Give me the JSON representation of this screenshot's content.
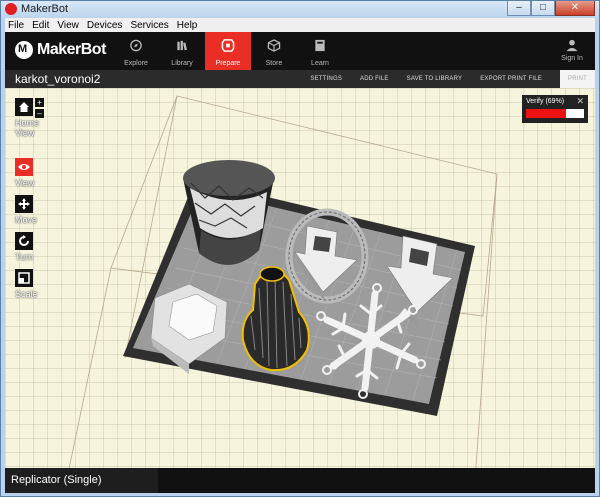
{
  "window": {
    "title": "MakerBot",
    "min": "–",
    "max": "□",
    "close": "✕"
  },
  "menu": [
    "File",
    "Edit",
    "View",
    "Devices",
    "Services",
    "Help"
  ],
  "brand": "MakerBot",
  "nav": [
    {
      "label": "Explore",
      "icon": "compass-icon"
    },
    {
      "label": "Library",
      "icon": "library-icon"
    },
    {
      "label": "Prepare",
      "icon": "prepare-icon",
      "active": true
    },
    {
      "label": "Store",
      "icon": "cube-icon"
    },
    {
      "label": "Learn",
      "icon": "book-icon"
    }
  ],
  "sign_in": "Sign In",
  "project": {
    "title": "karkot_voronoi2",
    "actions": [
      "SETTINGS",
      "ADD FILE",
      "SAVE TO LIBRARY",
      "EXPORT PRINT FILE",
      "PRINT"
    ]
  },
  "tools": [
    {
      "label": "Home View",
      "icon": "home-icon"
    },
    {
      "label": "View",
      "icon": "eye-icon",
      "active": true
    },
    {
      "label": "Move",
      "icon": "move-icon"
    },
    {
      "label": "Turn",
      "icon": "rotate-icon"
    },
    {
      "label": "Scale",
      "icon": "scale-icon"
    }
  ],
  "zoom": {
    "in": "+",
    "out": "–"
  },
  "verify": {
    "label": "Verify (69%)",
    "progress": 0.69,
    "close": "✕"
  },
  "status": {
    "printer": "Replicator (Single)"
  },
  "colors": {
    "accent": "#ea2d25",
    "header": "#111111",
    "grid": "#f6f4dc",
    "platform": "#9a9a9a"
  }
}
